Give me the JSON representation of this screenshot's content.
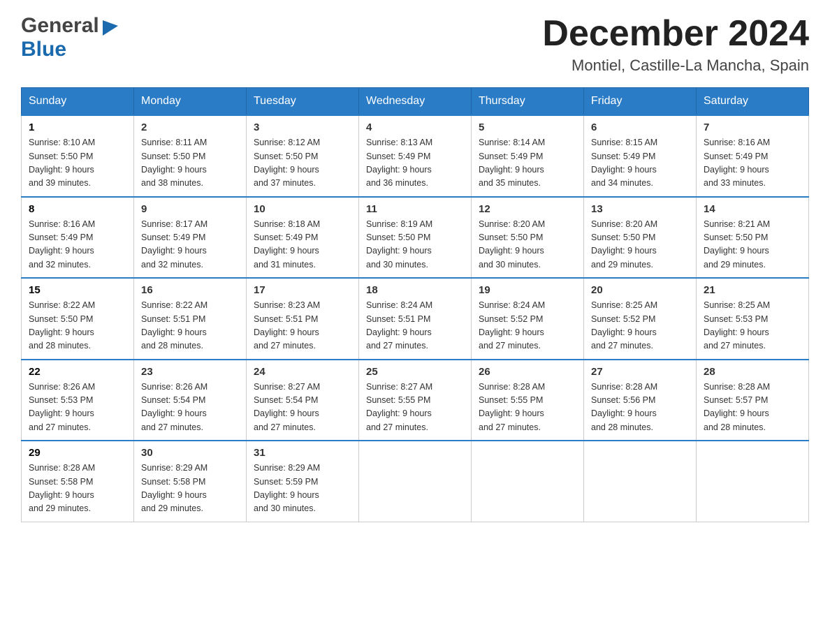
{
  "header": {
    "logo_general": "General",
    "logo_blue": "Blue",
    "month_title": "December 2024",
    "location": "Montiel, Castille-La Mancha, Spain"
  },
  "days_of_week": [
    "Sunday",
    "Monday",
    "Tuesday",
    "Wednesday",
    "Thursday",
    "Friday",
    "Saturday"
  ],
  "weeks": [
    [
      {
        "date": "1",
        "sunrise": "8:10 AM",
        "sunset": "5:50 PM",
        "daylight": "9 hours and 39 minutes."
      },
      {
        "date": "2",
        "sunrise": "8:11 AM",
        "sunset": "5:50 PM",
        "daylight": "9 hours and 38 minutes."
      },
      {
        "date": "3",
        "sunrise": "8:12 AM",
        "sunset": "5:50 PM",
        "daylight": "9 hours and 37 minutes."
      },
      {
        "date": "4",
        "sunrise": "8:13 AM",
        "sunset": "5:49 PM",
        "daylight": "9 hours and 36 minutes."
      },
      {
        "date": "5",
        "sunrise": "8:14 AM",
        "sunset": "5:49 PM",
        "daylight": "9 hours and 35 minutes."
      },
      {
        "date": "6",
        "sunrise": "8:15 AM",
        "sunset": "5:49 PM",
        "daylight": "9 hours and 34 minutes."
      },
      {
        "date": "7",
        "sunrise": "8:16 AM",
        "sunset": "5:49 PM",
        "daylight": "9 hours and 33 minutes."
      }
    ],
    [
      {
        "date": "8",
        "sunrise": "8:16 AM",
        "sunset": "5:49 PM",
        "daylight": "9 hours and 32 minutes."
      },
      {
        "date": "9",
        "sunrise": "8:17 AM",
        "sunset": "5:49 PM",
        "daylight": "9 hours and 32 minutes."
      },
      {
        "date": "10",
        "sunrise": "8:18 AM",
        "sunset": "5:49 PM",
        "daylight": "9 hours and 31 minutes."
      },
      {
        "date": "11",
        "sunrise": "8:19 AM",
        "sunset": "5:50 PM",
        "daylight": "9 hours and 30 minutes."
      },
      {
        "date": "12",
        "sunrise": "8:20 AM",
        "sunset": "5:50 PM",
        "daylight": "9 hours and 30 minutes."
      },
      {
        "date": "13",
        "sunrise": "8:20 AM",
        "sunset": "5:50 PM",
        "daylight": "9 hours and 29 minutes."
      },
      {
        "date": "14",
        "sunrise": "8:21 AM",
        "sunset": "5:50 PM",
        "daylight": "9 hours and 29 minutes."
      }
    ],
    [
      {
        "date": "15",
        "sunrise": "8:22 AM",
        "sunset": "5:50 PM",
        "daylight": "9 hours and 28 minutes."
      },
      {
        "date": "16",
        "sunrise": "8:22 AM",
        "sunset": "5:51 PM",
        "daylight": "9 hours and 28 minutes."
      },
      {
        "date": "17",
        "sunrise": "8:23 AM",
        "sunset": "5:51 PM",
        "daylight": "9 hours and 27 minutes."
      },
      {
        "date": "18",
        "sunrise": "8:24 AM",
        "sunset": "5:51 PM",
        "daylight": "9 hours and 27 minutes."
      },
      {
        "date": "19",
        "sunrise": "8:24 AM",
        "sunset": "5:52 PM",
        "daylight": "9 hours and 27 minutes."
      },
      {
        "date": "20",
        "sunrise": "8:25 AM",
        "sunset": "5:52 PM",
        "daylight": "9 hours and 27 minutes."
      },
      {
        "date": "21",
        "sunrise": "8:25 AM",
        "sunset": "5:53 PM",
        "daylight": "9 hours and 27 minutes."
      }
    ],
    [
      {
        "date": "22",
        "sunrise": "8:26 AM",
        "sunset": "5:53 PM",
        "daylight": "9 hours and 27 minutes."
      },
      {
        "date": "23",
        "sunrise": "8:26 AM",
        "sunset": "5:54 PM",
        "daylight": "9 hours and 27 minutes."
      },
      {
        "date": "24",
        "sunrise": "8:27 AM",
        "sunset": "5:54 PM",
        "daylight": "9 hours and 27 minutes."
      },
      {
        "date": "25",
        "sunrise": "8:27 AM",
        "sunset": "5:55 PM",
        "daylight": "9 hours and 27 minutes."
      },
      {
        "date": "26",
        "sunrise": "8:28 AM",
        "sunset": "5:55 PM",
        "daylight": "9 hours and 27 minutes."
      },
      {
        "date": "27",
        "sunrise": "8:28 AM",
        "sunset": "5:56 PM",
        "daylight": "9 hours and 28 minutes."
      },
      {
        "date": "28",
        "sunrise": "8:28 AM",
        "sunset": "5:57 PM",
        "daylight": "9 hours and 28 minutes."
      }
    ],
    [
      {
        "date": "29",
        "sunrise": "8:28 AM",
        "sunset": "5:58 PM",
        "daylight": "9 hours and 29 minutes."
      },
      {
        "date": "30",
        "sunrise": "8:29 AM",
        "sunset": "5:58 PM",
        "daylight": "9 hours and 29 minutes."
      },
      {
        "date": "31",
        "sunrise": "8:29 AM",
        "sunset": "5:59 PM",
        "daylight": "9 hours and 30 minutes."
      },
      null,
      null,
      null,
      null
    ]
  ]
}
